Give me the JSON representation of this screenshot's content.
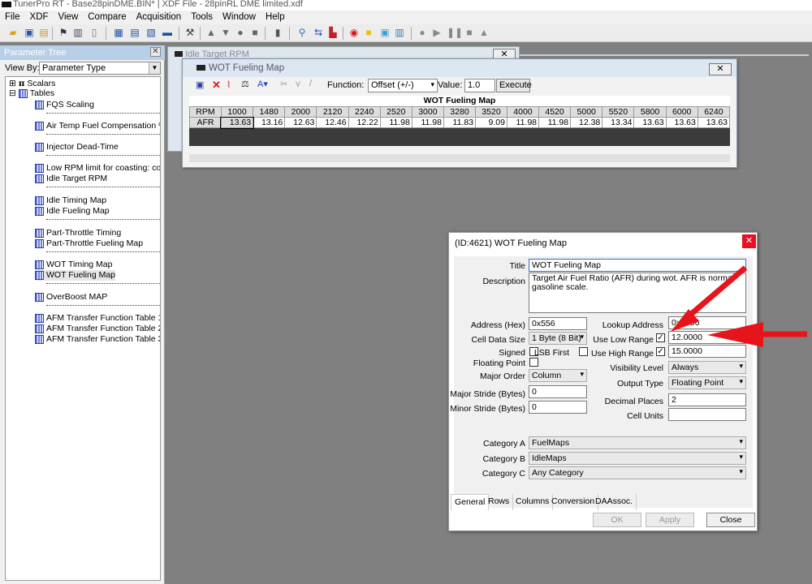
{
  "app": {
    "title": "TunerPro RT - Base28pinDME.BIN* | XDF File - 28pinRL DME limited.xdf"
  },
  "menu": [
    "File",
    "XDF",
    "View",
    "Compare",
    "Acquisition",
    "Tools",
    "Window",
    "Help"
  ],
  "tree_panel": {
    "header": "Parameter Tree",
    "view_by_label": "View By:",
    "view_by_value": "Parameter Type",
    "root_scalars": "Scalars",
    "root_tables": "Tables",
    "items": [
      "FQS Scaling",
      "Air Temp Fuel Compensation %",
      "Injector Dead-Time",
      "Low RPM limit for coasting: coolant b",
      "Idle Target RPM",
      "Idle Timing Map",
      "Idle Fueling Map",
      "Part-Throttle Timing",
      "Part-Throttle Fueling Map",
      "WOT Timing Map",
      "WOT Fueling Map",
      "OverBoost MAP",
      "AFM Transfer Function Table 1",
      "AFM Transfer Function Table 2",
      "AFM Transfer Function Table 3"
    ]
  },
  "idle_window": {
    "title": "Idle Target RPM"
  },
  "wot_window": {
    "title": "WOT Fueling Map",
    "function_label": "Function:",
    "function_value": "Offset (+/-)",
    "value_label": "Value:",
    "value": "1.0",
    "execute": "Execute",
    "map_title": "WOT Fueling Map",
    "row_axis_label": "RPM",
    "col_label": "AFR",
    "rpm": [
      "1000",
      "1480",
      "2000",
      "2120",
      "2240",
      "2520",
      "3000",
      "3280",
      "3520",
      "4000",
      "4520",
      "5000",
      "5520",
      "5800",
      "6000",
      "6240"
    ],
    "afr": [
      "13.63",
      "13.16",
      "12.63",
      "12.46",
      "12.22",
      "11.98",
      "11.98",
      "11.83",
      "9.09",
      "11.98",
      "11.98",
      "12.38",
      "13.34",
      "13.63",
      "13.63",
      "13.63"
    ]
  },
  "dialog": {
    "title": "(ID:4621) WOT Fueling Map",
    "title_label": "Title",
    "title_value": "WOT Fueling Map",
    "description_label": "Description",
    "description_value": "Target Air Fuel Ratio (AFR) during wot.  AFR is normal gasoline scale.",
    "address_label": "Address (Hex)",
    "address_value": "0x556",
    "cell_size_label": "Cell Data Size",
    "cell_size_value": "1 Byte (8 Bit)",
    "signed_label": "Signed",
    "lsb_label": "LSB First",
    "floating_label": "Floating Point",
    "major_order_label": "Major Order",
    "major_order_value": "Column",
    "major_stride_label": "Major Stride (Bytes)",
    "major_stride_value": "0",
    "minor_stride_label": "Minor Stride (Bytes)",
    "minor_stride_value": "0",
    "lookup_label": "Lookup Address",
    "lookup_value": "0x1556",
    "use_low_label": "Use Low Range",
    "low_value": "12.0000",
    "use_high_label": "Use High Range",
    "high_value": "15.0000",
    "visibility_label": "Visibility Level",
    "visibility_value": "Always",
    "output_label": "Output Type",
    "output_value": "Floating Point",
    "decimal_label": "Decimal Places",
    "decimal_value": "2",
    "units_label": "Cell Units",
    "units_value": "",
    "cat_a_label": "Category A",
    "cat_a_value": "FuelMaps",
    "cat_b_label": "Category B",
    "cat_b_value": "IdleMaps",
    "cat_c_label": "Category C",
    "cat_c_value": "Any Category",
    "tabs": [
      "General",
      "Rows",
      "Columns",
      "Conversion",
      "DAAssoc."
    ],
    "ok": "OK",
    "apply": "Apply",
    "close": "Close"
  },
  "colors": {
    "arrow": "#e8141b",
    "tree_header": "#b8cfe8"
  }
}
